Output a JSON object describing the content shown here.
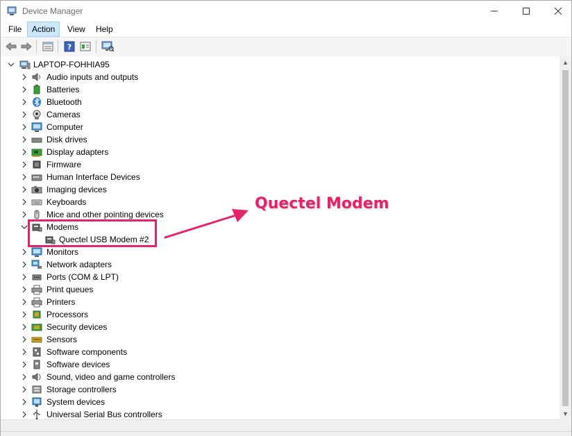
{
  "window": {
    "title": "Device Manager"
  },
  "menu": [
    {
      "label": "File",
      "active": false
    },
    {
      "label": "Action",
      "active": true
    },
    {
      "label": "View",
      "active": false
    },
    {
      "label": "Help",
      "active": false
    }
  ],
  "tree": {
    "root": "LAPTOP-FOHHIA95",
    "items": [
      {
        "label": "Audio inputs and outputs",
        "icon": "speaker-icon"
      },
      {
        "label": "Batteries",
        "icon": "battery-icon"
      },
      {
        "label": "Bluetooth",
        "icon": "bluetooth-icon"
      },
      {
        "label": "Cameras",
        "icon": "camera-icon"
      },
      {
        "label": "Computer",
        "icon": "monitor-icon"
      },
      {
        "label": "Disk drives",
        "icon": "disk-drive-icon"
      },
      {
        "label": "Display adapters",
        "icon": "display-adapter-icon"
      },
      {
        "label": "Firmware",
        "icon": "chip-icon"
      },
      {
        "label": "Human Interface Devices",
        "icon": "hid-icon"
      },
      {
        "label": "Imaging devices",
        "icon": "imaging-icon"
      },
      {
        "label": "Keyboards",
        "icon": "keyboard-icon"
      },
      {
        "label": "Mice and other pointing devices",
        "icon": "mouse-icon"
      },
      {
        "label": "Modems",
        "icon": "modem-icon",
        "expanded": true
      },
      {
        "label": "Quectel USB Modem #2",
        "icon": "modem-icon",
        "child": true
      },
      {
        "label": "Monitors",
        "icon": "monitor-icon"
      },
      {
        "label": "Network adapters",
        "icon": "network-icon"
      },
      {
        "label": "Ports (COM & LPT)",
        "icon": "port-icon"
      },
      {
        "label": "Print queues",
        "icon": "printer-icon"
      },
      {
        "label": "Printers",
        "icon": "printer-icon"
      },
      {
        "label": "Processors",
        "icon": "processor-icon"
      },
      {
        "label": "Security devices",
        "icon": "security-icon"
      },
      {
        "label": "Sensors",
        "icon": "sensor-icon"
      },
      {
        "label": "Software components",
        "icon": "software-component-icon"
      },
      {
        "label": "Software devices",
        "icon": "software-device-icon"
      },
      {
        "label": "Sound, video and game controllers",
        "icon": "sound-icon"
      },
      {
        "label": "Storage controllers",
        "icon": "storage-icon"
      },
      {
        "label": "System devices",
        "icon": "system-icon"
      },
      {
        "label": "Universal Serial Bus controllers",
        "icon": "usb-icon"
      }
    ]
  },
  "annotation": {
    "text": "Quectel Modem",
    "color": "#e8226a"
  },
  "colors": {
    "menu_active_bg": "#cce8ff",
    "annotation": "#e8226a"
  }
}
